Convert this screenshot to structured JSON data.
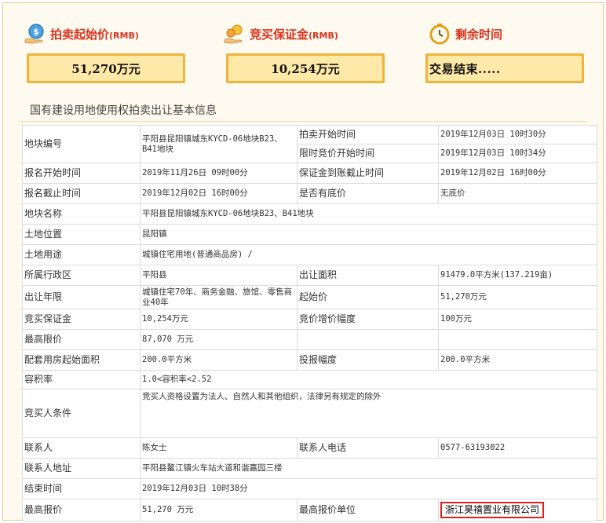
{
  "header": {
    "start_price": {
      "label": "拍卖起始价",
      "unit": "(RMB)",
      "value": "51,270万元",
      "icon": "money-hand-icon"
    },
    "deposit": {
      "label": "竞买保证金",
      "unit": "(RMB)",
      "value": "10,254万元",
      "icon": "coin-hand-icon"
    },
    "remaining": {
      "label": "剩余时间",
      "value": "交易结束.....",
      "icon": "clock-icon"
    }
  },
  "section_title": "国有建设用地使用权拍卖出让基本信息",
  "info": {
    "parcel_no_label": "地块编号",
    "parcel_no": "平阳县昆阳镇城东KYCD-06地块B23、B41地块",
    "auction_start_label": "拍卖开始时间",
    "auction_start": "2019年12月03日 10时30分",
    "limited_start_label": "限时竞价开始时间",
    "limited_start": "2019年12月03日 10时34分",
    "signup_start_label": "报名开始时间",
    "signup_start": "2019年11月26日 09时00分",
    "deposit_deadline_label": "保证金到账截止时间",
    "deposit_deadline": "2019年12月02日 16时00分",
    "signup_end_label": "报名截止时间",
    "signup_end": "2019年12月02日 16时00分",
    "reserve_label": "是否有底价",
    "reserve": "无底价",
    "parcel_name_label": "地块名称",
    "parcel_name": "平阳县昆阳镇城东KYCD-06地块B23、B41地块",
    "location_label": "土地位置",
    "location": "昆阳镇",
    "usage_label": "土地用途",
    "usage": "城镇住宅用地(普通商品房) /",
    "district_label": "所属行政区",
    "district": "平阳县",
    "area_label": "出让面积",
    "area": "91479.0平方米(137.219亩)",
    "term_label": "出让年限",
    "term": "城镇住宅70年、商务金融、旅馆、零售商业40年",
    "start_price_label": "起始价",
    "start_price": "51,270万元",
    "deposit_label": "竞买保证金",
    "deposit": "10,254万元",
    "increment_label": "竞价增价幅度",
    "increment": "100万元",
    "max_price_label": "最高限价",
    "max_price": "87,070 万元",
    "housing_area_label": "配套用房起始面积",
    "housing_area": "200.0平方米",
    "bid_step_label": "投报幅度",
    "bid_step": "200.0平方米",
    "far_label": "容积率",
    "far": "1.0<容积率<2.52",
    "conditions_label": "竞买人条件",
    "conditions": "竞买人资格设置为法人、自然人和其他组织，法律另有规定的除外",
    "contact_label": "联系人",
    "contact": "陈女士",
    "phone_label": "联系人电话",
    "phone": "0577-63193022",
    "address_label": "联系人地址",
    "address": "平阳县鳌江镇火车站大道和谐嘉园三楼",
    "end_time_label": "结束时间",
    "end_time": "2019年12月03日 10时38分",
    "top_bid_label": "最高报价",
    "top_bid": "51,270 万元",
    "top_bidder_label": "最高报价单位",
    "top_bidder": "浙江昊禧置业有限公司"
  },
  "colors": {
    "accent": "#d9331d",
    "box_fill": "#ffe9a8",
    "box_border": "#f0b43c",
    "highlight": "#e02020"
  }
}
